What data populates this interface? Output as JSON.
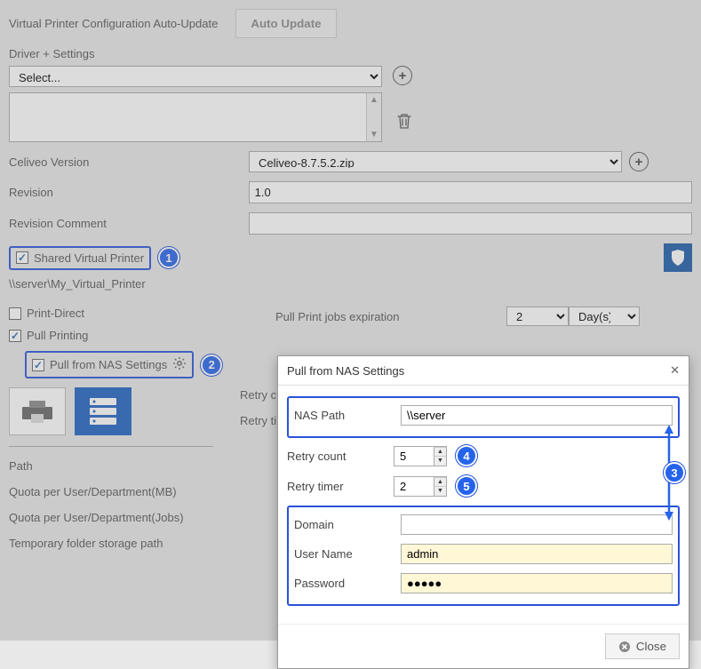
{
  "top": {
    "config_label": "Virtual Printer Configuration Auto-Update",
    "auto_update_btn": "Auto Update",
    "driver_settings_label": "Driver + Settings",
    "select_placeholder": "Select...",
    "celiveo_version_label": "Celiveo Version",
    "celiveo_version_value": "Celiveo-8.7.5.2.zip",
    "revision_label": "Revision",
    "revision_value": "1.0",
    "revision_comment_label": "Revision Comment",
    "revision_comment_value": "",
    "shared_printer_label": "Shared Virtual Printer",
    "shared_path": "\\\\server\\My_Virtual_Printer"
  },
  "mid": {
    "print_direct_label": "Print-Direct",
    "pull_printing_label": "Pull Printing",
    "pull_nas_label": "Pull from NAS Settings",
    "pull_expiration_label": "Pull Print jobs expiration",
    "pull_expiration_value": "2",
    "pull_expiration_unit": "Day(s)",
    "retry_c_partial": "Retry c",
    "retry_t_partial": "Retry ti"
  },
  "bottom": {
    "path_label": "Path",
    "quota_mb_label": "Quota per User/Department(MB)",
    "quota_jobs_label": "Quota per User/Department(Jobs)",
    "temp_folder_label": "Temporary folder storage path"
  },
  "modal": {
    "title": "Pull from NAS Settings",
    "nas_path_label": "NAS Path",
    "nas_path_value": "\\\\server",
    "retry_count_label": "Retry count",
    "retry_count_value": "5",
    "retry_timer_label": "Retry timer",
    "retry_timer_value": "2",
    "domain_label": "Domain",
    "domain_value": "",
    "username_label": "User Name",
    "username_value": "admin",
    "password_label": "Password",
    "password_value": "●●●●●",
    "close_btn": "Close"
  },
  "callouts": {
    "c1": "1",
    "c2": "2",
    "c3": "3",
    "c4": "4",
    "c5": "5"
  }
}
